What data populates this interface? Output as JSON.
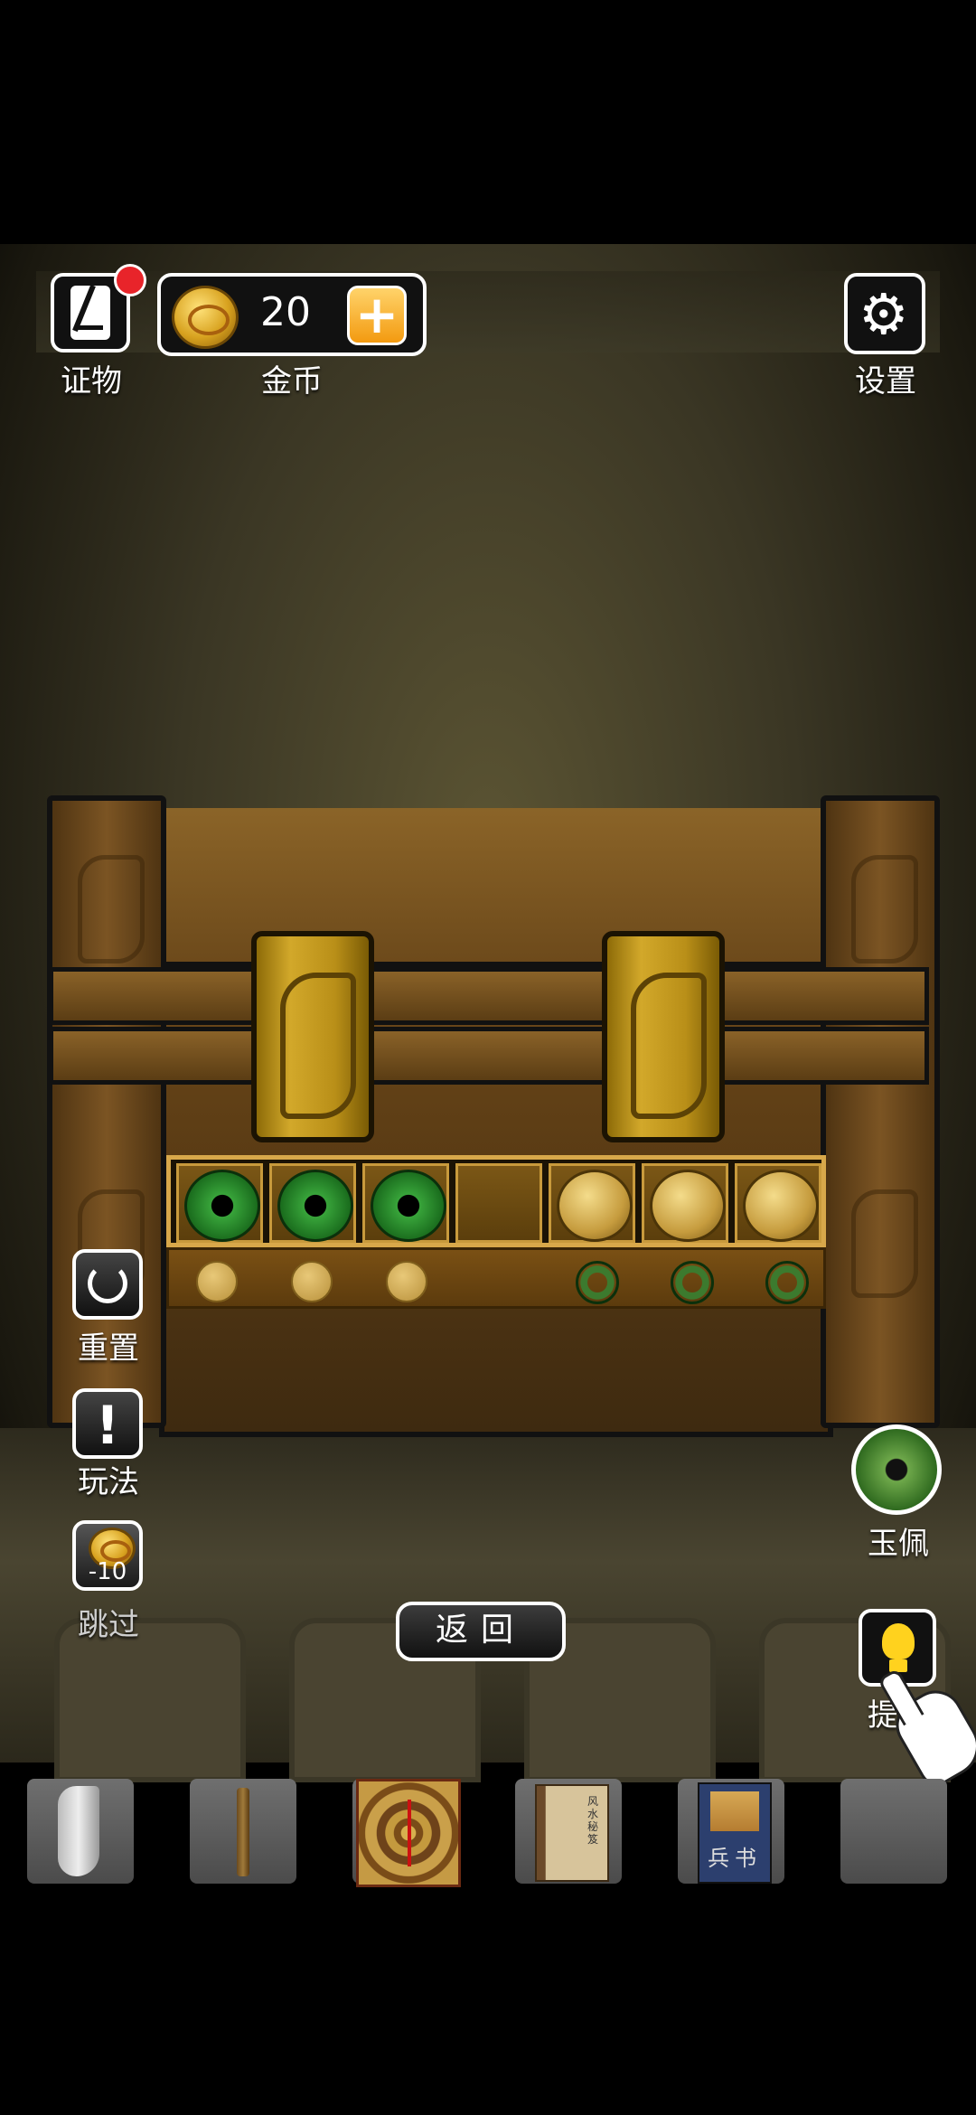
{
  "hud": {
    "evidence_label": "证物",
    "coins_value": "20",
    "coins_label": "金币",
    "settings_label": "设置"
  },
  "puzzle": {
    "slots": [
      "jade",
      "jade",
      "jade",
      "empty",
      "gold",
      "gold",
      "gold"
    ],
    "target": [
      "gold",
      "gold",
      "gold",
      "empty",
      "jade",
      "jade",
      "jade"
    ]
  },
  "side": {
    "reset_label": "重置",
    "howto_label": "玩法",
    "skip_cost": "-10",
    "skip_label": "跳过"
  },
  "item": {
    "jade_label": "玉佩"
  },
  "bottom": {
    "back_label": "返回",
    "hint_label": "提示"
  },
  "inventory": {
    "items": [
      "tooth-icon",
      "scroll-rod-icon",
      "compass-icon",
      "book-icon",
      "military-book-icon",
      "empty"
    ],
    "book_title": "风水秘笈",
    "military_book_title": "兵书"
  },
  "colors": {
    "accent": "#f39a10",
    "badge": "#e8242a",
    "jade": "#38a43a",
    "gold": "#c69c3e"
  }
}
